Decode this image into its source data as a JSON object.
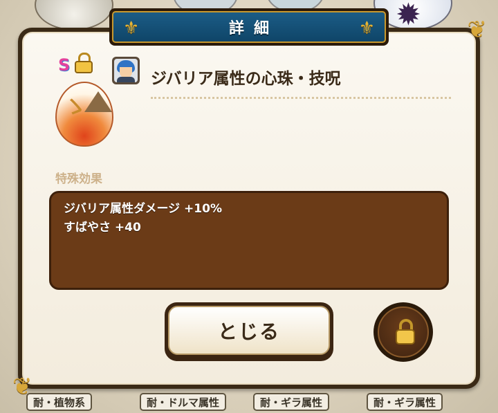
{
  "dialog": {
    "title": "詳細",
    "item_name": "ジバリア属性の心珠・技呪",
    "rank": "S",
    "effects_label": "特殊効果",
    "effects": [
      "ジバリア属性ダメージ +10%",
      "すばやさ +40"
    ],
    "close_label": "とじる"
  },
  "background_tags": [
    "耐・植物系",
    "耐・ドルマ属性",
    "耐・ギラ属性",
    "耐・ギラ属性"
  ],
  "icons": {
    "gem": "jewel-egg-icon",
    "lock": "lock-icon",
    "portrait": "character-portrait-icon"
  },
  "colors": {
    "title_banner": "#0f4568",
    "effects_box": "#6b3b17",
    "gold_trim": "#d7a73a",
    "rank_pink": "#e4429c"
  }
}
